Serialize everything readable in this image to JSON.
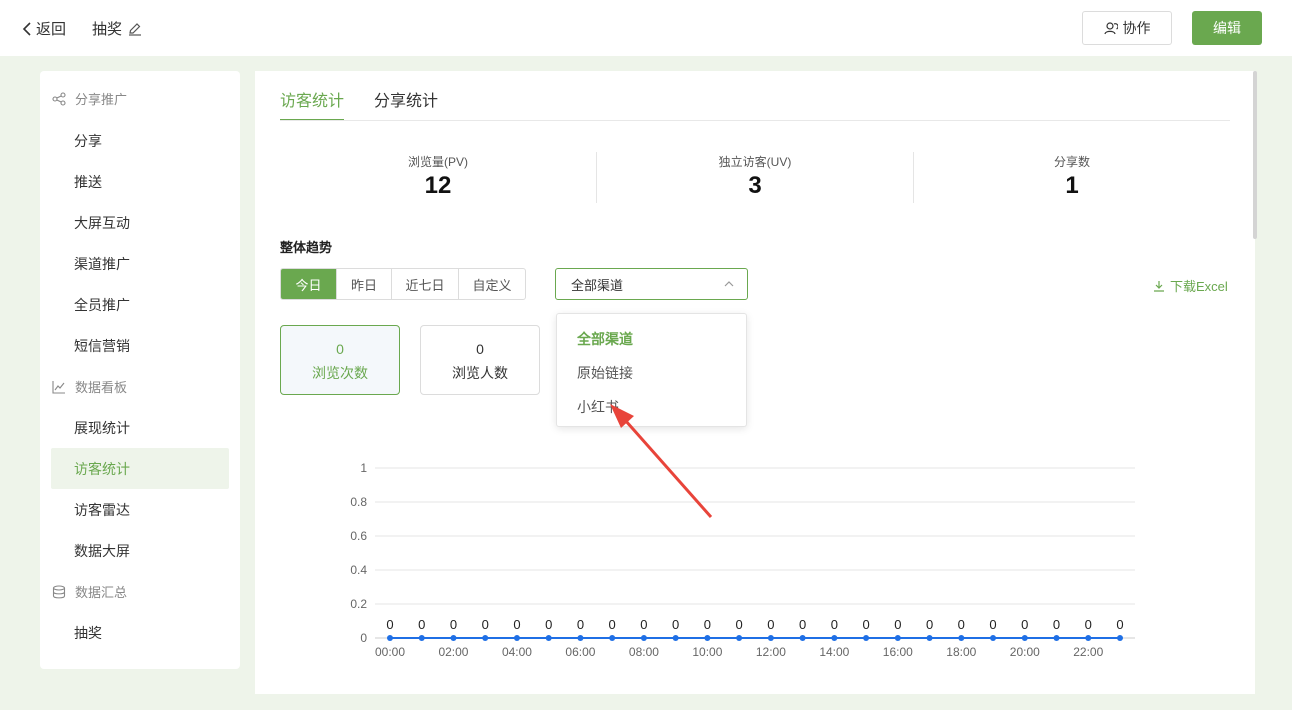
{
  "header": {
    "back_label": "返回",
    "page_title": "抽奖",
    "collab_label": "协作",
    "edit_label": "编辑"
  },
  "sidebar": {
    "groups": [
      {
        "label": "分享推广",
        "icon": "share-icon",
        "items": [
          "分享",
          "推送",
          "大屏互动",
          "渠道推广",
          "全员推广",
          "短信营销"
        ]
      },
      {
        "label": "数据看板",
        "icon": "chart-line-icon",
        "items": [
          "展现统计",
          "访客统计",
          "访客雷达",
          "数据大屏"
        ]
      },
      {
        "label": "数据汇总",
        "icon": "database-icon",
        "items": [
          "抽奖"
        ]
      }
    ],
    "active_item": "访客统计"
  },
  "tabs": [
    {
      "label": "访客统计",
      "active": true
    },
    {
      "label": "分享统计",
      "active": false
    }
  ],
  "stats": [
    {
      "label": "浏览量(PV)",
      "value": "12"
    },
    {
      "label": "独立访客(UV)",
      "value": "3"
    },
    {
      "label": "分享数",
      "value": "1"
    }
  ],
  "trend": {
    "title": "整体趋势",
    "ranges": [
      "今日",
      "昨日",
      "近七日",
      "自定义"
    ],
    "active_range": "今日",
    "channel_select": {
      "value": "全部渠道"
    },
    "download_label": "下载Excel",
    "metric_cards": [
      {
        "value": "0",
        "label": "浏览次数",
        "active": true
      },
      {
        "value": "0",
        "label": "浏览人数",
        "active": false
      }
    ],
    "dropdown_options": [
      "全部渠道",
      "原始链接",
      "小红书"
    ],
    "dropdown_selected": "全部渠道"
  },
  "colors": {
    "accent": "#6aa84f",
    "line": "#1f6fe5",
    "annotation_arrow": "#e8443a"
  },
  "chart_data": {
    "type": "line",
    "x": [
      "00:00",
      "01:00",
      "02:00",
      "03:00",
      "04:00",
      "05:00",
      "06:00",
      "07:00",
      "08:00",
      "09:00",
      "10:00",
      "11:00",
      "12:00",
      "13:00",
      "14:00",
      "15:00",
      "16:00",
      "17:00",
      "18:00",
      "19:00",
      "20:00",
      "21:00",
      "22:00",
      "23:00"
    ],
    "xtick_labels": [
      "00:00",
      "02:00",
      "04:00",
      "06:00",
      "08:00",
      "10:00",
      "12:00",
      "14:00",
      "16:00",
      "18:00",
      "20:00",
      "22:00"
    ],
    "series": [
      {
        "values": [
          0,
          0,
          0,
          0,
          0,
          0,
          0,
          0,
          0,
          0,
          0,
          0,
          0,
          0,
          0,
          0,
          0,
          0,
          0,
          0,
          0,
          0,
          0,
          0
        ]
      }
    ],
    "yticks": [
      0,
      0.2,
      0.4,
      0.6,
      0.8,
      1
    ],
    "ylim": [
      0,
      1
    ],
    "grid": true,
    "data_labels": true
  }
}
